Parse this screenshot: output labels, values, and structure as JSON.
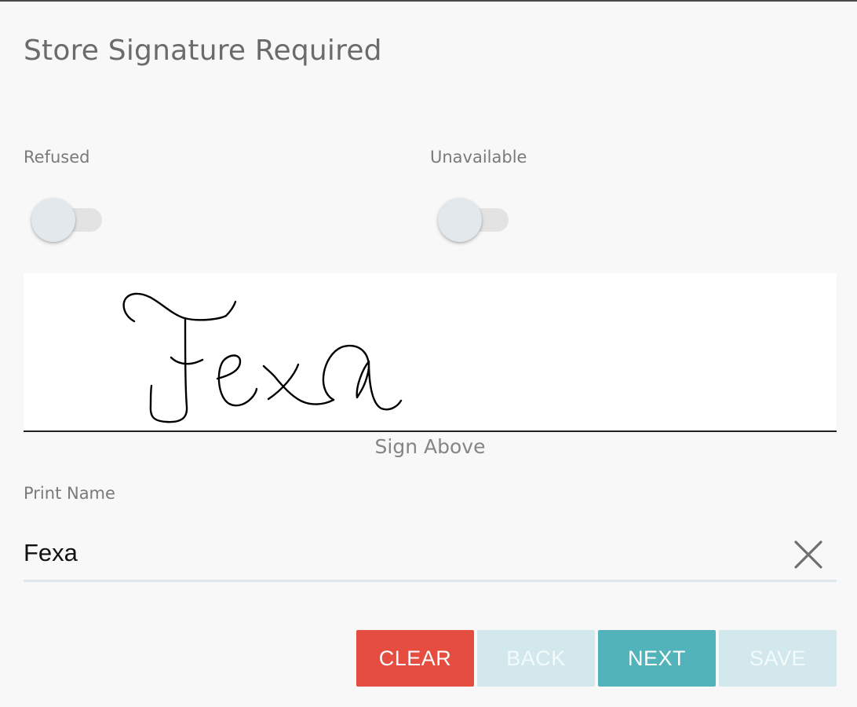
{
  "dialog": {
    "title": "Store Signature Required"
  },
  "toggles": {
    "refused": {
      "label": "Refused",
      "checked": false
    },
    "unavailable": {
      "label": "Unavailable",
      "checked": false
    }
  },
  "signature": {
    "caption": "Sign Above",
    "signed_text": "Fexa"
  },
  "print_name": {
    "label": "Print Name",
    "value": "Fexa"
  },
  "buttons": {
    "clear": "CLEAR",
    "back": "BACK",
    "next": "NEXT",
    "save": "SAVE"
  },
  "colors": {
    "clear_button": "#e44d3f",
    "next_button": "#52b3bb",
    "disabled_button": "#d3e8ec"
  }
}
